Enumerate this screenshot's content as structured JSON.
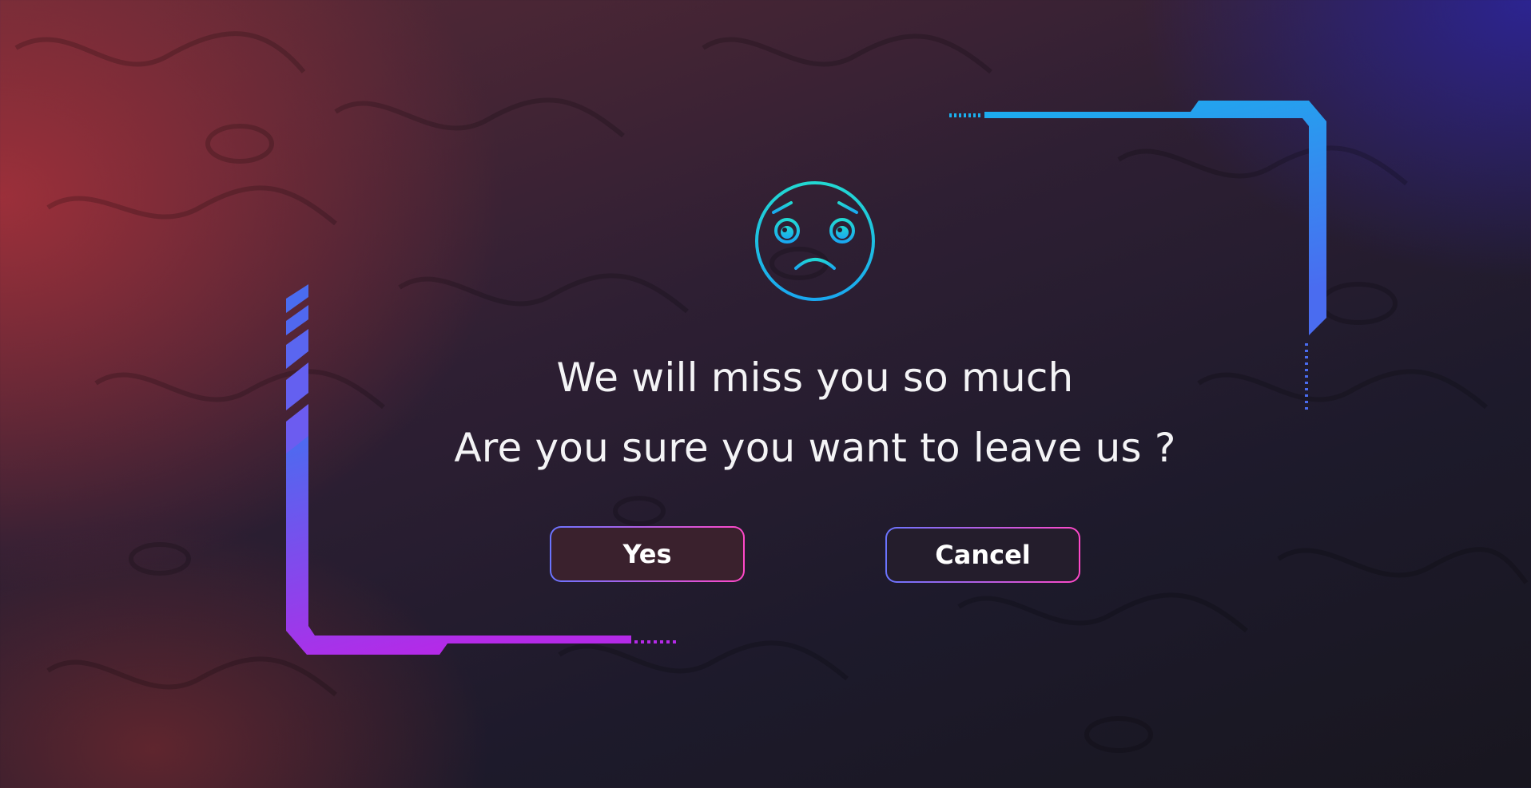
{
  "dialog": {
    "icon": "sad-face-icon",
    "message_line1": "We will miss you so much",
    "message_line2": "Are you sure you want to leave us ?",
    "yes_label": "Yes",
    "cancel_label": "Cancel"
  },
  "colors": {
    "icon_gradient_start": "#22d8d2",
    "icon_gradient_end": "#1aa8f0",
    "frame_top_right": "#1ab0ee",
    "frame_bottom_left": "#b42ae8",
    "button_border_start": "#6a74ff",
    "button_border_end": "#ff48c8",
    "text": "#f4f4f6"
  }
}
